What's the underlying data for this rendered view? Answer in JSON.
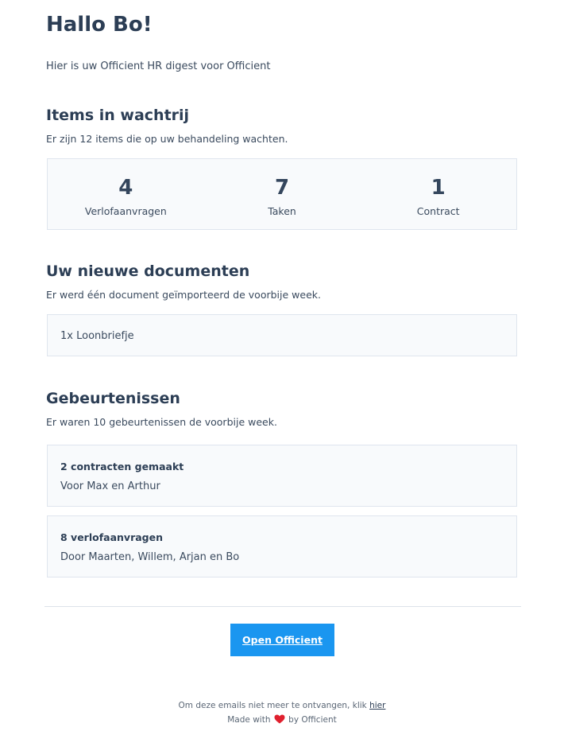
{
  "greeting": "Hallo Bo!",
  "intro": "Hier is uw Officient HR digest voor Officient",
  "queue": {
    "heading": "Items in wachtrij",
    "subtitle": "Er zijn 12 items die op uw behandeling wachten.",
    "stats": [
      {
        "value": "4",
        "label": "Verlofaanvragen"
      },
      {
        "value": "7",
        "label": "Taken"
      },
      {
        "value": "1",
        "label": "Contract"
      }
    ]
  },
  "documents": {
    "heading": "Uw nieuwe documenten",
    "subtitle": "Er werd één document geïmporteerd de voorbije week.",
    "items": [
      "1x Loonbriefje"
    ]
  },
  "events": {
    "heading": "Gebeurtenissen",
    "subtitle": "Er waren 10 gebeurtenissen de voorbije week.",
    "items": [
      {
        "title": "2 contracten gemaakt",
        "description": "Voor Max en Arthur"
      },
      {
        "title": "8 verlofaanvragen",
        "description": "Door Maarten, Willem, Arjan en Bo"
      }
    ]
  },
  "cta_label": "Open Officient",
  "footer": {
    "unsubscribe_text": "Om deze emails niet meer te ontvangen, klik",
    "unsubscribe_link": "hier",
    "made_with": "Made with",
    "by": "by Officient"
  },
  "colors": {
    "primary_button": "#1a96f0",
    "heading": "#2c3e55",
    "heart": "#e0202e"
  },
  "icons": {
    "heart": "heart-icon"
  }
}
